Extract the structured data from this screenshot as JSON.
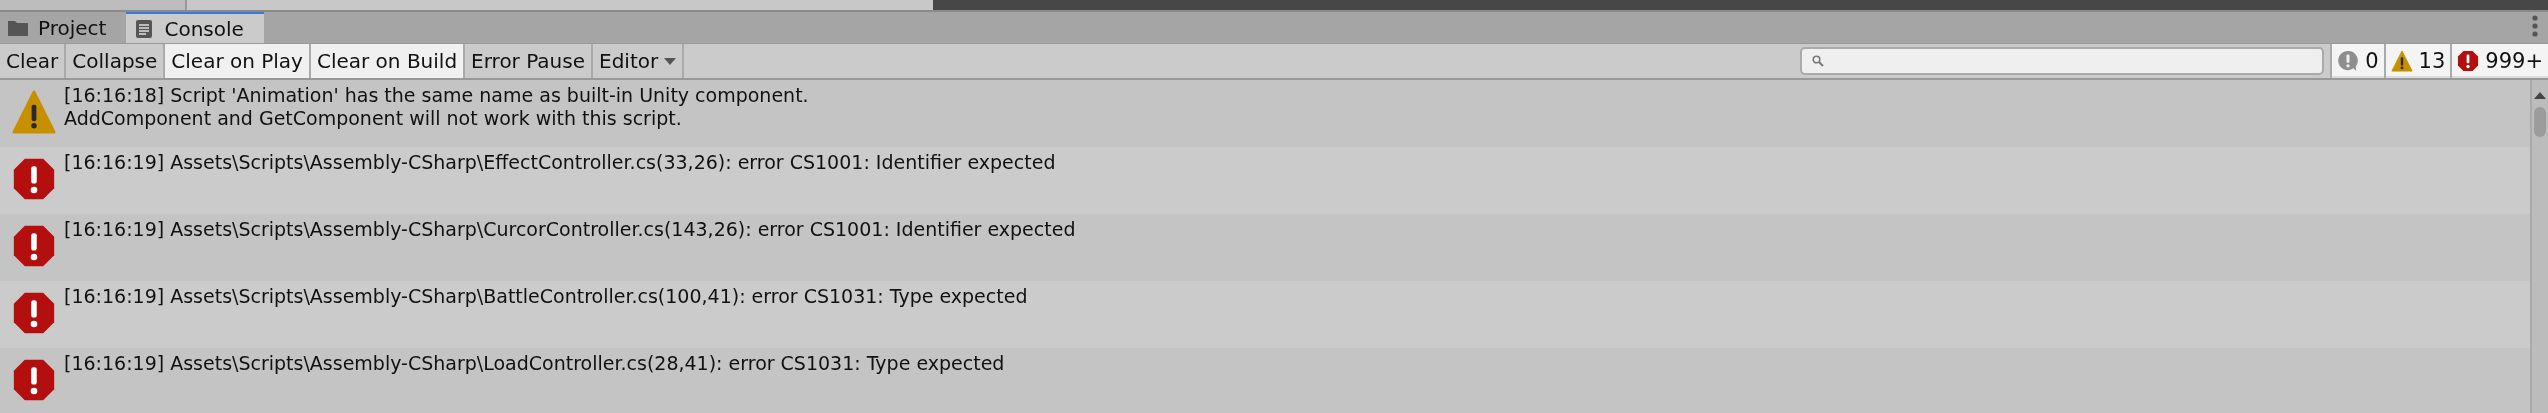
{
  "tabs": [
    {
      "label": "Project",
      "kind": "folder",
      "selected": false
    },
    {
      "label": "Console",
      "kind": "console",
      "selected": true
    }
  ],
  "toolbar": {
    "buttons": [
      {
        "label": "Clear",
        "on": false,
        "kind": "button"
      },
      {
        "label": "Collapse",
        "on": false,
        "kind": "toggle"
      },
      {
        "label": "Clear on Play",
        "on": true,
        "kind": "toggle"
      },
      {
        "label": "Clear on Build",
        "on": true,
        "kind": "toggle"
      },
      {
        "label": "Error Pause",
        "on": false,
        "kind": "toggle"
      },
      {
        "label": "Editor",
        "on": false,
        "kind": "dropdown"
      }
    ],
    "counters": [
      {
        "kind": "info",
        "count": "0",
        "on": true
      },
      {
        "kind": "warning",
        "count": "13",
        "on": true
      },
      {
        "kind": "error",
        "count": "999+",
        "on": true
      }
    ]
  },
  "log": [
    {
      "kind": "warning",
      "lines": [
        "[16:16:18] Script 'Animation' has the same name as built-in Unity component.",
        "AddComponent and GetComponent will not work with this script."
      ]
    },
    {
      "kind": "error",
      "lines": [
        "[16:16:19] Assets\\Scripts\\Assembly-CSharp\\EffectController.cs(33,26): error CS1001: Identifier expected"
      ]
    },
    {
      "kind": "error",
      "lines": [
        "[16:16:19] Assets\\Scripts\\Assembly-CSharp\\CurcorController.cs(143,26): error CS1001: Identifier expected"
      ]
    },
    {
      "kind": "error",
      "lines": [
        "[16:16:19] Assets\\Scripts\\Assembly-CSharp\\BattleController.cs(100,41): error CS1031: Type expected"
      ]
    },
    {
      "kind": "error",
      "lines": [
        "[16:16:19] Assets\\Scripts\\Assembly-CSharp\\LoadController.cs(28,41): error CS1031: Type expected"
      ]
    }
  ]
}
